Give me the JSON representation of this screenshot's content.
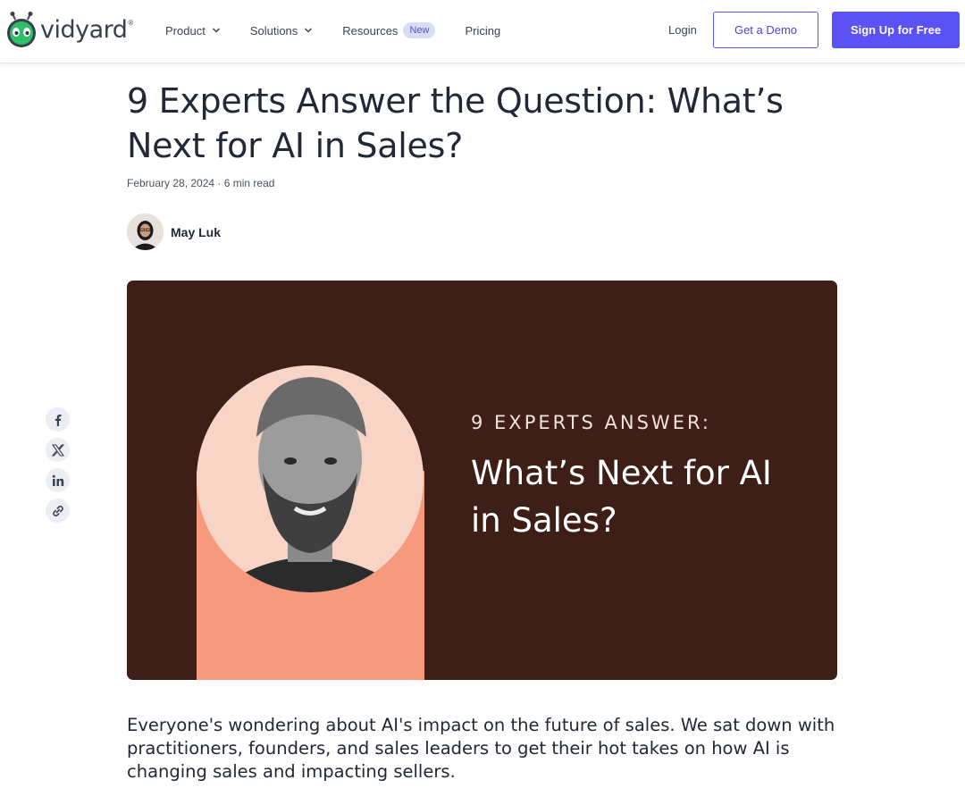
{
  "header": {
    "logo_text": "vidyard",
    "logo_mark": "®",
    "nav": [
      {
        "label": "Product",
        "icon": "chevron-down-icon"
      },
      {
        "label": "Solutions",
        "icon": "chevron-down-icon"
      },
      {
        "label": "Resources",
        "badge": "New"
      },
      {
        "label": "Pricing"
      }
    ],
    "login": "Login",
    "demo_button": "Get a Demo",
    "signup_button": "Sign Up for Free",
    "accent_color": "#5b52f5"
  },
  "article": {
    "title": "9 Experts Answer the Question: What’s Next for AI in Sales?",
    "meta": "February 28, 2024 · 6 min read",
    "author": "May Luk",
    "hero": {
      "kicker": "9 EXPERTS ANSWER:",
      "headline": "What’s Next for AI in Sales?",
      "background_color": "#3d1f17",
      "accent_color": "#f59a7c"
    },
    "lede": "Everyone's wondering about AI's impact on the future of sales. We sat down with practitioners, founders, and sales leaders to get their hot takes on how AI is changing sales and impacting sellers."
  },
  "share": [
    {
      "icon": "facebook-icon"
    },
    {
      "icon": "x-icon"
    },
    {
      "icon": "linkedin-icon"
    },
    {
      "icon": "link-icon"
    }
  ]
}
